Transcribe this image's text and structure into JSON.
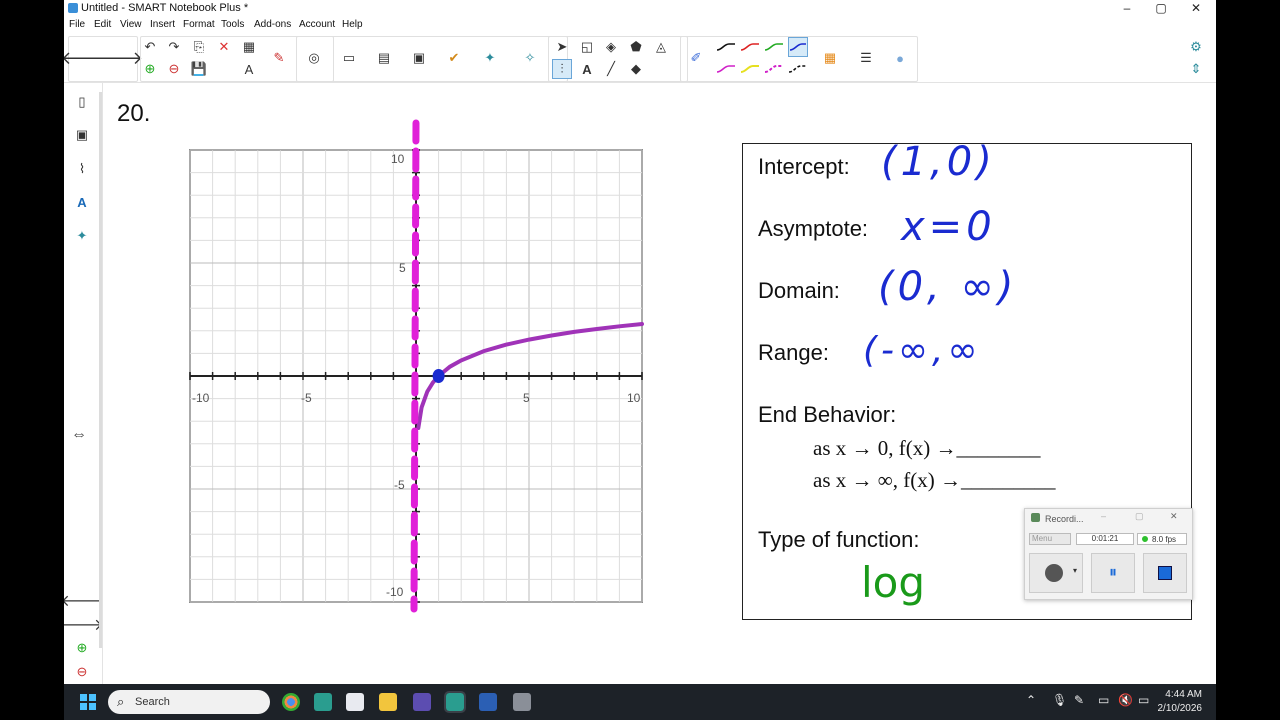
{
  "window": {
    "title": "Untitled - SMART Notebook Plus *"
  },
  "menu": [
    "File",
    "Edit",
    "View",
    "Insert",
    "Format",
    "Tools",
    "Add-ons",
    "Account",
    "Help"
  ],
  "page": {
    "question_number": "20."
  },
  "graph": {
    "x_ticks": [
      "-10",
      "-5",
      "5",
      "10"
    ],
    "y_ticks": [
      "10",
      "5",
      "-5",
      "-10"
    ]
  },
  "chart_data": {
    "type": "line",
    "xlim": [
      -10,
      10
    ],
    "ylim": [
      -10,
      10
    ],
    "grid": true,
    "series": [
      {
        "x": [
          0.1,
          0.25,
          0.5,
          0.75,
          1,
          1.5,
          2,
          3,
          4,
          5,
          6,
          7,
          8,
          9,
          10
        ],
        "y": [
          -2.3,
          -1.39,
          -0.69,
          -0.29,
          0,
          0.41,
          0.69,
          1.1,
          1.39,
          1.61,
          1.79,
          1.95,
          2.08,
          2.2,
          2.3
        ],
        "color": "#a033b8"
      }
    ],
    "asymptote": {
      "x": 0,
      "color": "#e020d8"
    },
    "points": [
      {
        "x": 1,
        "y": 0,
        "color": "#1a2bd0"
      }
    ]
  },
  "info": {
    "intercept_label": "Intercept:",
    "intercept_answer": "(1,0)",
    "asymptote_label": "Asymptote:",
    "asymptote_answer": "x=0",
    "domain_label": "Domain:",
    "domain_answer": "(0, ∞)",
    "range_label": "Range:",
    "range_answer": "(-∞,∞",
    "end_behavior_label": "End Behavior:",
    "end_line1": "as x → 0, f(x) →________",
    "end_line2": "as x → ∞, f(x) →_________",
    "type_label": "Type of function:",
    "type_answer": "log"
  },
  "recorder": {
    "title": "Recordi...",
    "menu": "Menu",
    "time": "0:01:21",
    "fps": "8.0 fps"
  },
  "taskbar": {
    "search_placeholder": "Search",
    "time": "4:44 AM",
    "date": "2/10/2026"
  },
  "colors": {
    "accent_blue": "#1a2bd0",
    "asymptote_magenta": "#e020d8",
    "curve_purple": "#a033b8",
    "answer_green": "#1a9a1a"
  }
}
